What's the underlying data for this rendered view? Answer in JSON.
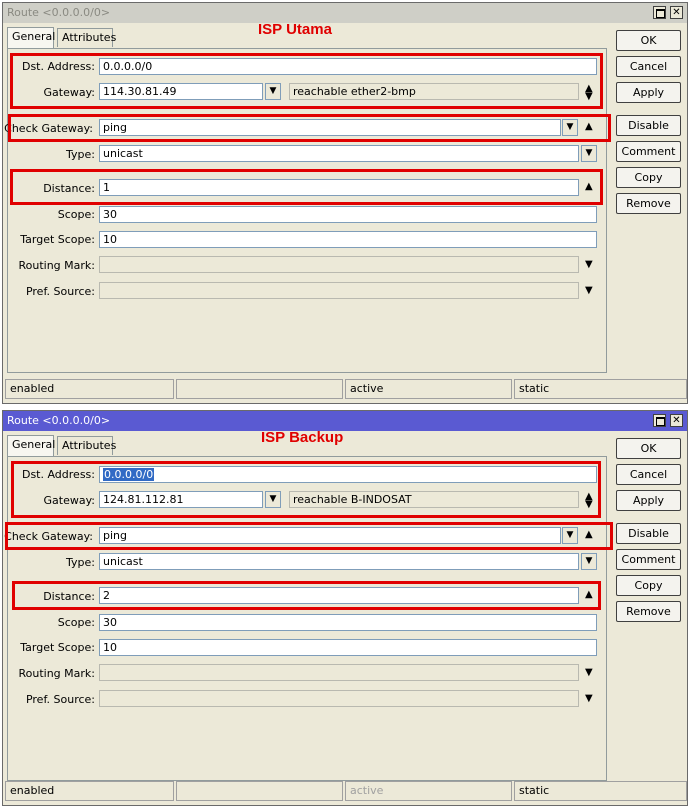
{
  "colors": {
    "annotation": "#e00000",
    "active_title": "#5a5ad2",
    "inactive_title": "#cfcfc7"
  },
  "common": {
    "tab_general": "General",
    "tab_attributes": "Attributes",
    "labels": {
      "dst_address": "Dst. Address:",
      "gateway": "Gateway:",
      "check_gateway": "Check Gateway:",
      "type": "Type:",
      "distance": "Distance:",
      "scope": "Scope:",
      "target_scope": "Target Scope:",
      "routing_mark": "Routing Mark:",
      "pref_source": "Pref. Source:"
    },
    "buttons": {
      "ok": "OK",
      "cancel": "Cancel",
      "apply": "Apply",
      "disable": "Disable",
      "comment": "Comment",
      "copy": "Copy",
      "remove": "Remove"
    },
    "icons": {
      "maximize": "maximize-icon",
      "close": "close-icon",
      "dropdown": "triangle-down-icon",
      "up": "triangle-up-icon"
    }
  },
  "window1": {
    "title": "Route <0.0.0.0/0>",
    "annotation": "ISP Utama",
    "dst_address": "0.0.0.0/0",
    "gateway": "114.30.81.49",
    "gateway_status": "reachable ether2-bmp",
    "check_gateway": "ping",
    "type": "unicast",
    "distance": "1",
    "scope": "30",
    "target_scope": "10",
    "routing_mark": "",
    "pref_source": "",
    "status": [
      "enabled",
      "",
      "active",
      "static"
    ]
  },
  "window2": {
    "title": "Route <0.0.0.0/0>",
    "annotation": "ISP Backup",
    "dst_address": "0.0.0.0/0",
    "gateway": "124.81.112.81",
    "gateway_status": "reachable B-INDOSAT",
    "check_gateway": "ping",
    "type": "unicast",
    "distance": "2",
    "scope": "30",
    "target_scope": "10",
    "routing_mark": "",
    "pref_source": "",
    "status": [
      "enabled",
      "",
      "active",
      "static"
    ]
  }
}
